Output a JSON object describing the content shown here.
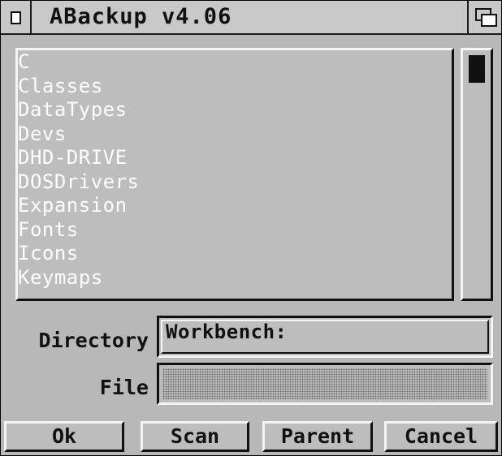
{
  "window": {
    "title": "ABackup v4.06"
  },
  "icons": {
    "close": "close-icon",
    "depth": "depth-arrange-icon"
  },
  "listview": {
    "items": [
      "C",
      "Classes",
      "DataTypes",
      "Devs",
      "DHD-DRIVE",
      "DOSDrivers",
      "Expansion",
      "Fonts",
      "Icons",
      "Keymaps"
    ]
  },
  "fields": {
    "directory_label": "Directory",
    "directory_value": "Workbench:",
    "file_label": "File",
    "file_value": ""
  },
  "buttons": {
    "ok": "Ok",
    "scan": "Scan",
    "parent": "Parent",
    "cancel": "Cancel"
  },
  "colors": {
    "window_bg": "#b8b8b8",
    "highlight": "#f4f4f4",
    "shadow": "#111111",
    "list_text": "#ffffff"
  }
}
